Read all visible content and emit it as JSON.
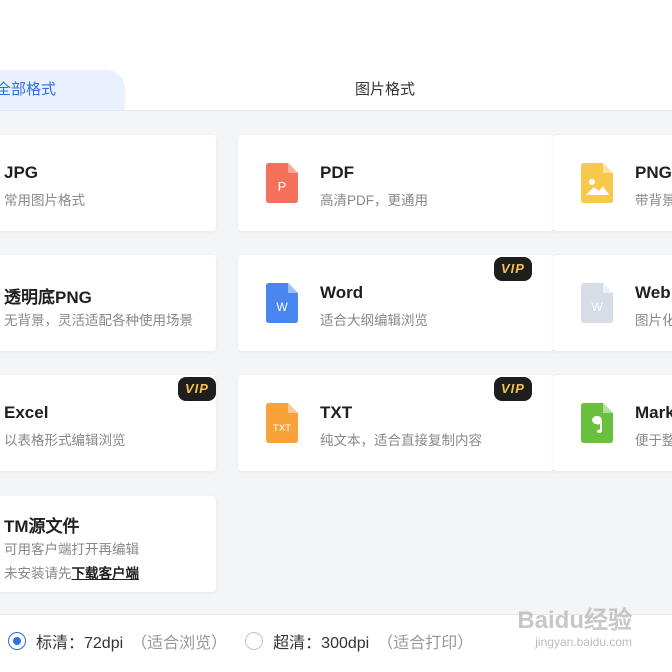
{
  "tabs": {
    "all": "全部格式",
    "image": "图片格式"
  },
  "formats": [
    {
      "title": "JPG",
      "desc": "常用图片格式",
      "icon": "jpg-icon",
      "vip": false
    },
    {
      "title": "PDF",
      "desc": "高清PDF，更通用",
      "icon": "pdf-icon",
      "vip": false,
      "icon_letter": "P",
      "color": "#f5705a"
    },
    {
      "title": "PNG",
      "desc": "带背景",
      "icon": "png-icon",
      "vip": false,
      "color": "#f7c94b"
    },
    {
      "title": "透明底PNG",
      "desc": "无背景，灵活适配各种使用场景",
      "icon": "transparent-png-icon",
      "vip": false
    },
    {
      "title": "Word",
      "desc": "适合大纲编辑浏览",
      "icon": "word-icon",
      "vip": true,
      "icon_letter": "W",
      "color": "#4a86f0"
    },
    {
      "title": "Web",
      "desc": "图片化",
      "icon": "web-icon",
      "vip": false,
      "icon_letter": "W",
      "color": "#d7dde6"
    },
    {
      "title": "Excel",
      "desc": "以表格形式编辑浏览",
      "icon": "excel-icon",
      "vip": true
    },
    {
      "title": "TXT",
      "desc": "纯文本，适合直接复制内容",
      "icon": "txt-icon",
      "vip": true,
      "icon_letter": "TXT",
      "color": "#f9a23a"
    },
    {
      "title": "Mark",
      "desc": "便于整理",
      "icon": "markdown-icon",
      "vip": false,
      "color": "#6bbf3e"
    },
    {
      "title": "TM源文件",
      "desc": "可用客户端打开再编辑",
      "desc2_prefix": "未安装请先",
      "desc2_link": "下载客户端",
      "icon": "tm-source-icon",
      "vip": false
    }
  ],
  "vip_label": "VIP",
  "quality": {
    "standard_label": "标清：72dpi",
    "standard_hint": "（适合浏览）",
    "ultra_label": "超清：300dpi",
    "ultra_hint": "（适合打印）",
    "selected": "standard"
  },
  "watermark": {
    "brand": "Baidu经验",
    "url": "jingyan.baidu.com"
  },
  "colors": {
    "accent": "#2f6fe6",
    "tab_active_bg": "#e9f1fe",
    "vip_bg": "#1e1e1e",
    "vip_text": "#f3c352"
  }
}
